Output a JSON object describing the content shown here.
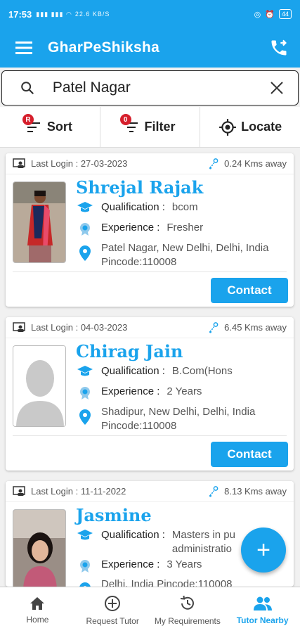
{
  "status": {
    "time": "17:53",
    "signal_text": "22.6 KB/S",
    "battery": "44"
  },
  "appbar": {
    "title": "GharPeShiksha"
  },
  "search": {
    "value": "Patel Nagar"
  },
  "toolbar": {
    "sort": {
      "label": "Sort",
      "badge": "R"
    },
    "filter": {
      "label": "Filter",
      "badge": "0"
    },
    "locate": {
      "label": "Locate"
    }
  },
  "tutors": [
    {
      "last_login": "Last Login : 27-03-2023",
      "distance": "0.24 Kms away",
      "name": "Shrejal Rajak",
      "qualification_key": "Qualification : ",
      "qualification_val": "bcom",
      "experience_key": "Experience :",
      "experience_val": "Fresher",
      "address_line1": "Patel Nagar, New Delhi, Delhi, India",
      "address_line2": "Pincode:110008",
      "contact": "Contact"
    },
    {
      "last_login": "Last Login : 04-03-2023",
      "distance": "6.45 Kms away",
      "name": "Chirag Jain",
      "qualification_key": "Qualification : ",
      "qualification_val": "B.Com(Hons",
      "experience_key": "Experience : ",
      "experience_val": "2 Years",
      "address_line1": "Shadipur, New Delhi, Delhi, India",
      "address_line2": "Pincode:110008",
      "contact": "Contact"
    },
    {
      "last_login": "Last Login : 11-11-2022",
      "distance": "8.13 Kms away",
      "name": "Jasmine",
      "qualification_key": "Qualification : ",
      "qualification_val": "Masters in pu",
      "qualification_val2": "administratio",
      "experience_key": "Experience : ",
      "experience_val": "3 Years",
      "address_line1": "Delhi, India Pincode:110008"
    }
  ],
  "fab": {
    "label": "+"
  },
  "bottomnav": {
    "home": "Home",
    "request": "Request Tutor",
    "requirements": "My Requirements",
    "nearby": "Tutor Nearby"
  },
  "colors": {
    "primary": "#1aa3ec",
    "badge": "#d61f2c"
  }
}
